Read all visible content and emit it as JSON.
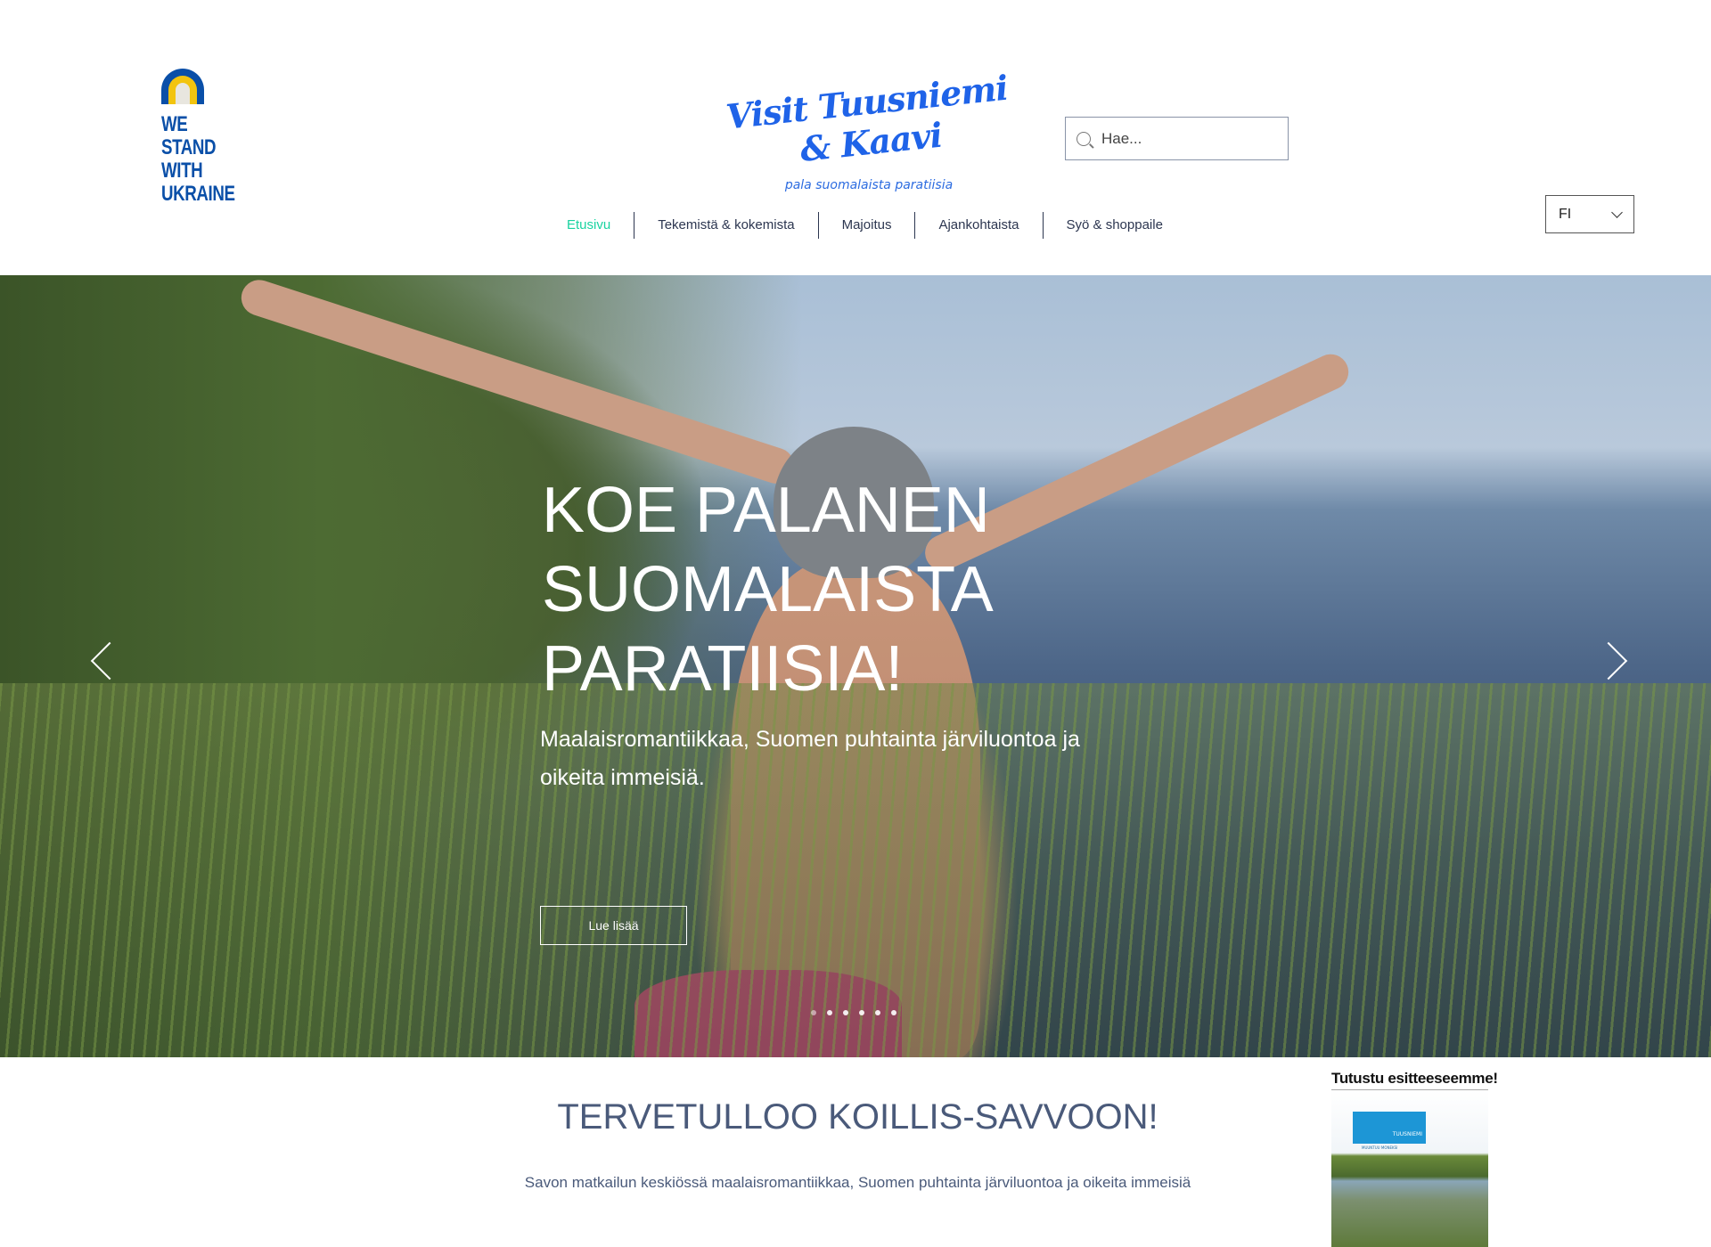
{
  "header": {
    "ukraine_badge": "WE STAND\nWITH\nUKRAINE",
    "brand_title": "Visit Tuusniemi & Kaavi",
    "brand_tagline": "pala suomalaista paratiisia",
    "search": {
      "placeholder": "Hae...",
      "icon": "search-icon"
    },
    "language": {
      "selected": "FI"
    },
    "nav": [
      {
        "label": "Etusivu",
        "active": true
      },
      {
        "label": "Tekemistä & kokemista"
      },
      {
        "label": "Majoitus"
      },
      {
        "label": "Ajankohtaista"
      },
      {
        "label": "Syö & shoppaile"
      }
    ],
    "colors": {
      "active_nav": "#19d3a0",
      "brand": "#1f63e8",
      "nav_text": "#2c3650"
    }
  },
  "hero": {
    "heading": "KOE PALANEN\nSUOMALAISTA\nPARATIISIA!",
    "subtitle": "Maalaisromantiikkaa, Suomen puhtainta järviluontoa ja oikeita immeisiä.",
    "button": "Lue lisää",
    "slides": 6,
    "current_slide": 1
  },
  "main": {
    "welcome": "TERVETULLOO KOILLIS-SAVVOON!",
    "intro": "Savon matkailun keskiössä maalaisromantiikkaa, Suomen puhtainta järviluontoa ja oikeita immeisiä"
  },
  "brochure": {
    "title": "Tutustu esitteeseemme!",
    "cover_logo": "TUUSNIEMI",
    "cover_slogan": "MUUNTUU MONEKSI"
  }
}
